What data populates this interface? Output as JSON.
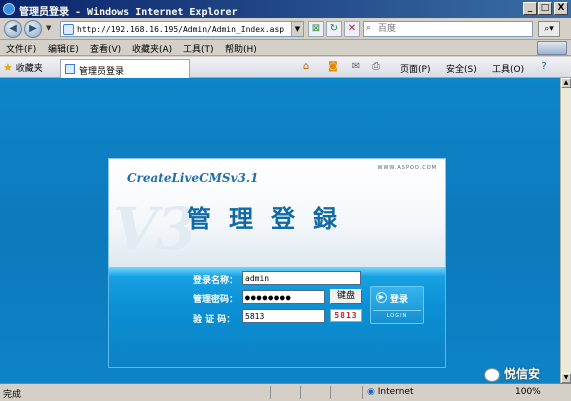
{
  "window": {
    "title": "管理员登录 - Windows Internet Explorer",
    "minimize": "_",
    "maximize": "□",
    "close": "X"
  },
  "address_bar": {
    "url": "http://192.168.16.195/Admin/Admin_Index.asp",
    "search_placeholder": "百度"
  },
  "menu": {
    "items": [
      "文件(F)",
      "编辑(E)",
      "查看(V)",
      "收藏夹(A)",
      "工具(T)",
      "帮助(H)"
    ]
  },
  "tabs": {
    "favorites": "收藏夹",
    "active_tab": "管理员登录"
  },
  "command_bar": {
    "page": "页面(P)",
    "safety": "安全(S)",
    "tools": "工具(O)"
  },
  "login_panel": {
    "brand": "CreateLiveCMSv3.1",
    "site": "WWW.ASPOO.COM",
    "watermark": "V3",
    "heading": "管理登録",
    "username_label": "登录名称：",
    "username_value": "admin",
    "password_label": "管理密码：",
    "password_value": "●●●●●●●●",
    "keyboard_button": "键盘",
    "captcha_label": "验 证 码：",
    "captcha_value": "5813",
    "captcha_image": "5813",
    "login_button_zh": "登录",
    "login_button_en": "LOGIN"
  },
  "status_bar": {
    "status": "完成",
    "zone": "Internet",
    "zoom": "100%"
  },
  "overlay": {
    "watermark": "悦信安"
  },
  "icons": {
    "back": "back-arrow-icon",
    "forward": "forward-arrow-icon",
    "refresh": "refresh-icon",
    "stop": "stop-icon",
    "search": "search-icon",
    "favorites": "star-icon",
    "home": "home-icon",
    "help": "help-icon"
  },
  "colors": {
    "titlebar_start": "#0a246a",
    "content_bg": "#0e85c8",
    "heading": "#0f6aa6",
    "captcha_text": "#c3232a"
  }
}
